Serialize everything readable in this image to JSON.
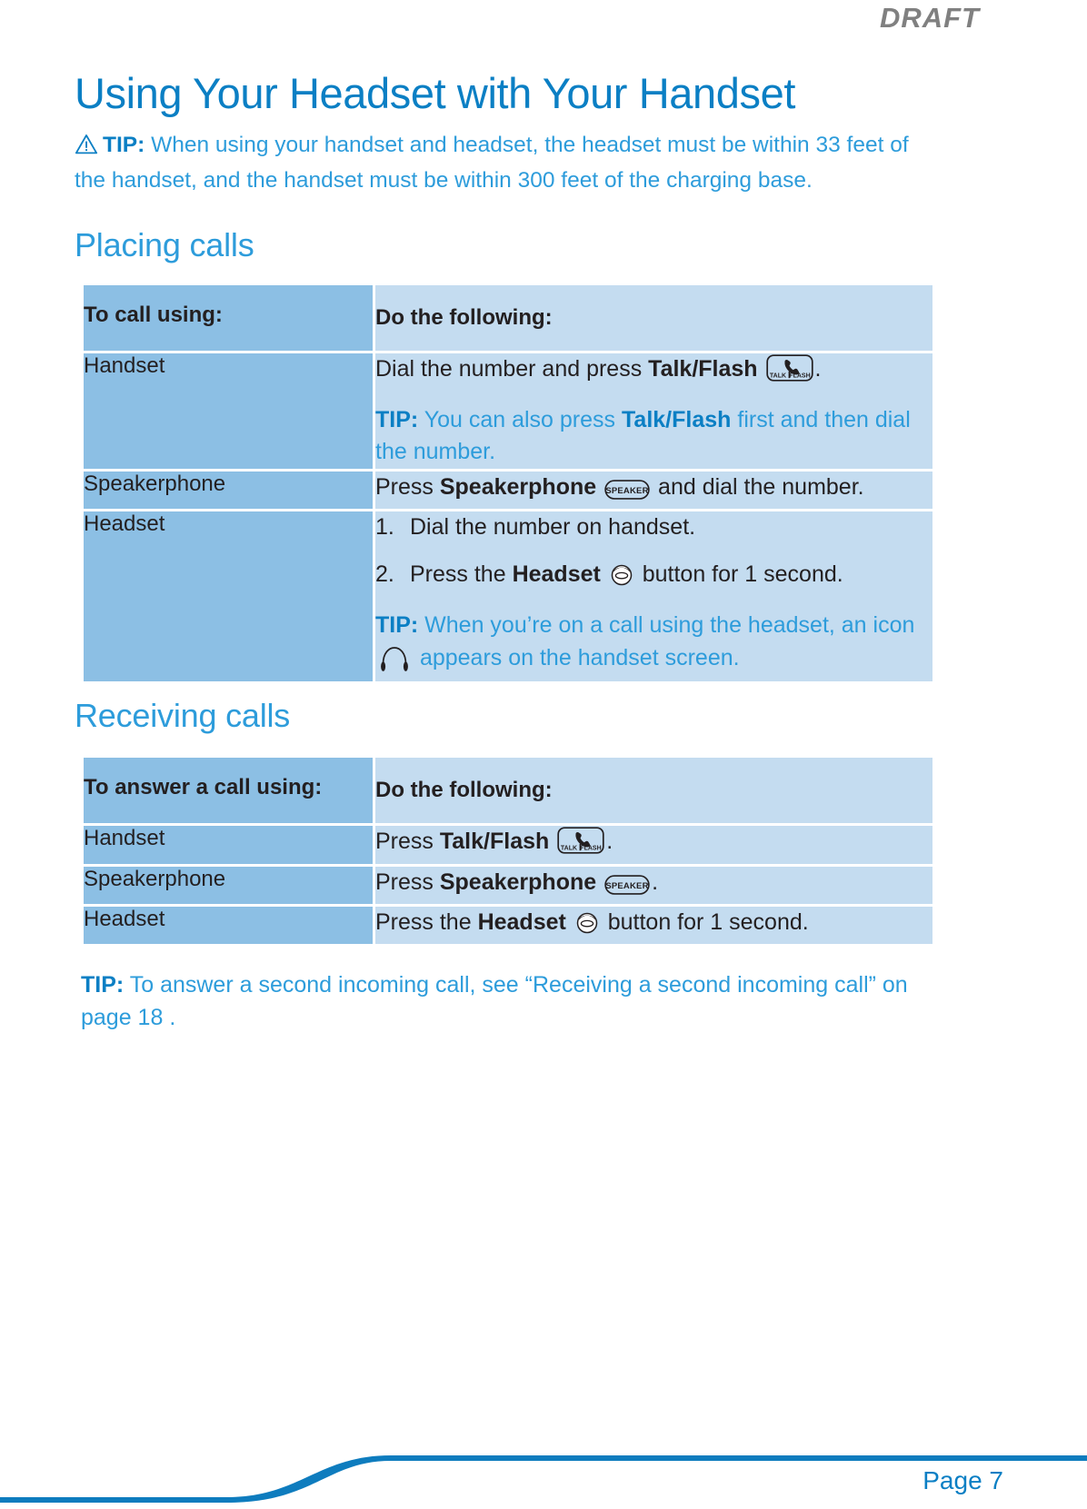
{
  "header": {
    "draft_label": "DRAFT"
  },
  "page": {
    "title": "Using Your Headset with Your Handset",
    "intro_tip": {
      "label": "TIP:",
      "text": " When using your handset and headset, the headset must be within 33 feet of the handset, and the handset must be within 300 feet of the charging base."
    }
  },
  "placing": {
    "heading": "Placing calls",
    "columns": [
      "To call using:",
      "Do the following:"
    ],
    "rows": [
      {
        "label": "Handset",
        "line1_a": "Dial the number and press ",
        "line1_b": "Talk/Flash",
        "line1_c": ".",
        "tip_label": "TIP:",
        "tip_a": " You can also press ",
        "tip_b": "Talk/Flash",
        "tip_c": " first and then dial the number."
      },
      {
        "label": "Speakerphone",
        "line1_a": "Press ",
        "line1_b": "Speakerphone",
        "line1_c": " and dial the number."
      },
      {
        "label": "Headset",
        "step1_num": "1.",
        "step1_text": "Dial the number on handset.",
        "step2_num": "2.",
        "step2_a": "Press the ",
        "step2_b": "Headset",
        "step2_c": " button for 1 second.",
        "tip_label": "TIP:",
        "tip_a": " When you’re on a call using the headset, an icon ",
        "tip_b": " appears on the handset screen."
      }
    ]
  },
  "receiving": {
    "heading": "Receiving calls",
    "columns": [
      "To answer a call using:",
      "Do the following:"
    ],
    "rows": [
      {
        "label": "Handset",
        "line1_a": "Press ",
        "line1_b": "Talk/Flash",
        "line1_c": "."
      },
      {
        "label": "Speakerphone",
        "line1_a": "Press ",
        "line1_b": "Speakerphone",
        "line1_c": "."
      },
      {
        "label": "Headset",
        "line1_a": "Press the ",
        "line1_b": "Headset",
        "line1_c": " button for 1 second."
      }
    ]
  },
  "bottom_tip": {
    "label": "TIP:",
    "text": " To answer a second incoming call, see “Receiving a second incoming call” on page 18 ."
  },
  "footer": {
    "page_label": "Page 7"
  },
  "icons": {
    "warning": "warning-triangle-icon",
    "talk_flash": "talk-flash-key-icon",
    "speaker": "speaker-key-icon",
    "headset_button": "headset-button-icon",
    "headphone": "headphone-icon"
  },
  "colors": {
    "brand_blue": "#0b7fc4",
    "tip_blue": "#2d9cdb",
    "table_left": "#8cbfe4",
    "table_right": "#c4dcf0",
    "draft_gray": "#808080"
  }
}
